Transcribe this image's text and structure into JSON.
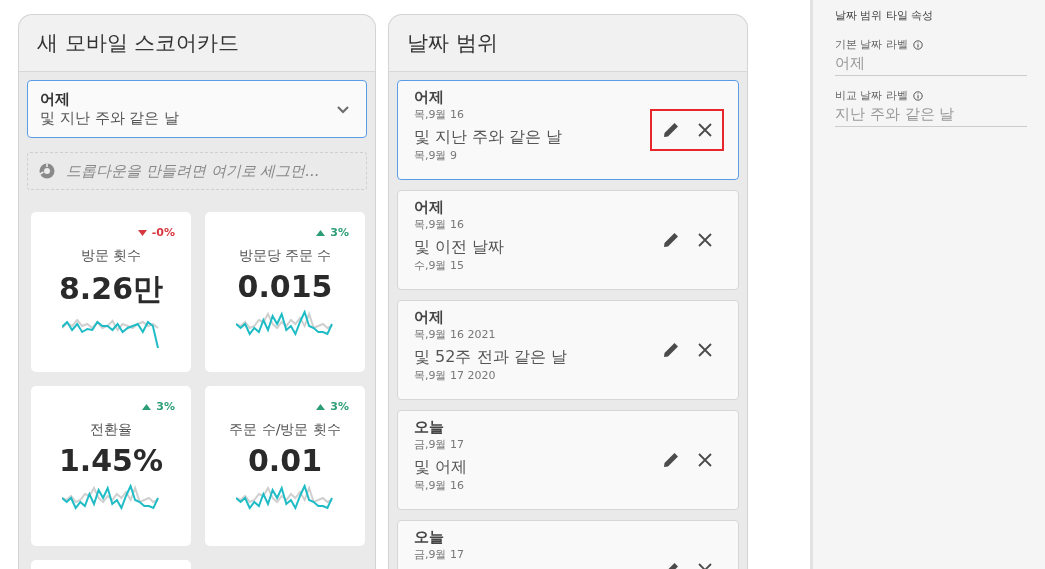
{
  "scorecard": {
    "title": "새 모바일 스코어카드",
    "dropdown": {
      "primary": "어제",
      "secondary": "및 지난 주와 같은 날"
    },
    "drop_zone": {
      "placeholder": "드롭다운을 만들려면 여기로 세그먼..."
    },
    "tiles": [
      {
        "label": "방문 횟수",
        "value": "8.26만",
        "delta": "-0%",
        "kind": "decrease"
      },
      {
        "label": "방문당 주문 수",
        "value": "0.015",
        "delta": "3%",
        "kind": "increase"
      },
      {
        "label": "전환율",
        "value": "1.45%",
        "delta": "3%",
        "kind": "increase"
      },
      {
        "label": "주문 수/방문 횟수",
        "value": "0.01",
        "delta": "3%",
        "kind": "increase"
      }
    ]
  },
  "date_ranges": {
    "title": "날짜 범위",
    "items": [
      {
        "name": "어제",
        "date": "목,9월 16",
        "compare": "및 지난 주와 같은 날",
        "compare_date": "목,9월 9",
        "selected": true,
        "highlighted": true
      },
      {
        "name": "어제",
        "date": "목,9월 16",
        "compare": "및 이전 날짜",
        "compare_date": "수,9월 15",
        "selected": false,
        "highlighted": false
      },
      {
        "name": "어제",
        "date": "목,9월 16 2021",
        "compare": "및 52주 전과 같은 날",
        "compare_date": "목,9월 17 2020",
        "selected": false,
        "highlighted": false
      },
      {
        "name": "오늘",
        "date": "금,9월 17",
        "compare": "및 어제",
        "compare_date": "목,9월 16",
        "selected": false,
        "highlighted": false
      },
      {
        "name": "오늘",
        "date": "금,9월 17",
        "selected": false,
        "highlighted": false
      }
    ]
  },
  "properties": {
    "title": "날짜 범위 타일 속성",
    "fields": [
      {
        "label": "기본 날짜 라벨",
        "placeholder": "어제"
      },
      {
        "label": "비교 날짜 라벨",
        "placeholder": "지난 주와 같은 날"
      }
    ]
  }
}
